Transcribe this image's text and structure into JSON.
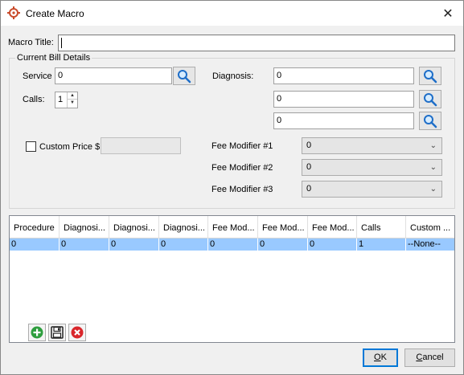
{
  "window": {
    "title": "Create Macro"
  },
  "macro_title": {
    "label": "Macro Title:",
    "value": ""
  },
  "current_bill": {
    "legend": "Current Bill Details",
    "service_label": "Service",
    "service_value": "0",
    "calls_label": "Calls:",
    "calls_value": "1",
    "diagnosis_label": "Diagnosis:",
    "diagnosis_values": [
      "0",
      "0",
      "0"
    ],
    "custom_price_label": "Custom Price $",
    "custom_price_value": "",
    "custom_price_checked": false,
    "fee_modifiers": [
      {
        "label": "Fee Modifier #1",
        "value": "0"
      },
      {
        "label": "Fee Modifier #2",
        "value": "0"
      },
      {
        "label": "Fee Modifier #3",
        "value": "0"
      }
    ]
  },
  "grid": {
    "columns": [
      "Procedure",
      "Diagnosi...",
      "Diagnosi...",
      "Diagnosi...",
      "Fee Mod...",
      "Fee Mod...",
      "Fee Mod...",
      "Calls",
      "Custom ..."
    ],
    "rows": [
      [
        "0",
        "0",
        "0",
        "0",
        "0",
        "0",
        "0",
        "1",
        "--None--"
      ]
    ]
  },
  "buttons": {
    "ok_prefix": "",
    "ok_accel": "O",
    "ok_rest": "K",
    "cancel_prefix": "",
    "cancel_accel": "C",
    "cancel_rest": "ancel"
  },
  "colors": {
    "selected_row": "#99c9ff",
    "add": "#2e9e3e",
    "delete": "#d9262b",
    "accent": "#0078d7"
  }
}
